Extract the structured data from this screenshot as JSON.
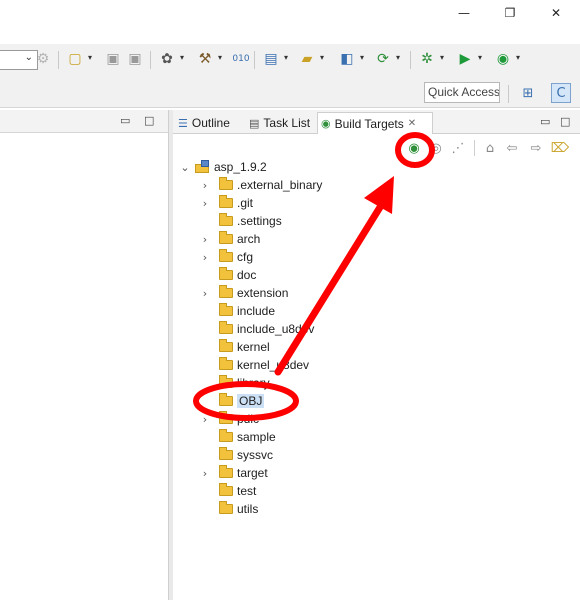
{
  "window": {
    "minimize": "—",
    "maximize": "❐",
    "close": "✕"
  },
  "toolbar": {
    "combo_chevron": "⌄",
    "quick_access": "Quick Access",
    "drop": "▾"
  },
  "view": {
    "tabs": [
      {
        "label": "Outline"
      },
      {
        "label": "Task List"
      },
      {
        "label": "Build Targets",
        "close": "✕"
      }
    ],
    "minimize": "▭",
    "maximize": "□"
  },
  "editor": {
    "minimize": "▭",
    "maximize": "□"
  },
  "tree": {
    "project": "asp_1.9.2",
    "items": [
      {
        "label": ".external_binary",
        "expandable": true
      },
      {
        "label": ".git",
        "expandable": true
      },
      {
        "label": ".settings",
        "expandable": false
      },
      {
        "label": "arch",
        "expandable": true
      },
      {
        "label": "cfg",
        "expandable": true
      },
      {
        "label": "doc",
        "expandable": false
      },
      {
        "label": "extension",
        "expandable": true
      },
      {
        "label": "include",
        "expandable": false
      },
      {
        "label": "include_u8dev",
        "expandable": false
      },
      {
        "label": "kernel",
        "expandable": false
      },
      {
        "label": "kernel_u8dev",
        "expandable": false
      },
      {
        "label": "library",
        "expandable": false
      },
      {
        "label": "OBJ",
        "expandable": false,
        "selected": true
      },
      {
        "label": "pdic",
        "expandable": true
      },
      {
        "label": "sample",
        "expandable": false
      },
      {
        "label": "syssvc",
        "expandable": false
      },
      {
        "label": "target",
        "expandable": true
      },
      {
        "label": "test",
        "expandable": false
      },
      {
        "label": "utils",
        "expandable": false
      }
    ]
  },
  "icons": {
    "twisty_expanded": "⌄",
    "twisty_collapsed": "›",
    "toolbar": [
      "new-wizard-icon",
      "save-icon",
      "save-all-icon",
      "debug-settings-icon",
      "build-hammer-icon",
      "binary-icon",
      "new-package-icon",
      "new-folder-icon",
      "new-class-icon",
      "refresh-icon",
      "debug-bug-icon",
      "run-icon",
      "run-external-icon"
    ],
    "view_toolbar": [
      "build-target-icon",
      "build-target-alt-icon",
      "collapse-icon",
      "home-icon",
      "back-arrow-icon",
      "forward-arrow-icon",
      "filter-icon"
    ]
  },
  "colors": {
    "annotation": "#ff0000",
    "selection": "#cce0f5",
    "folder": "#f2c23c"
  }
}
